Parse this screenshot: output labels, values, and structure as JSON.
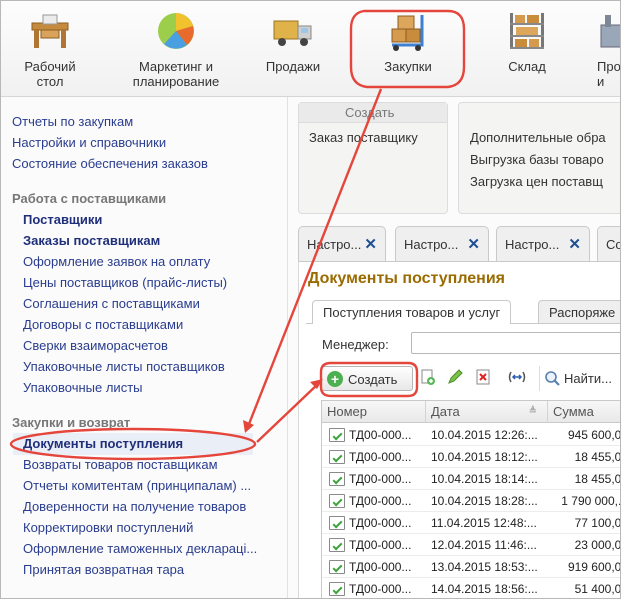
{
  "sections": [
    {
      "label": "Рабочий\nстол",
      "icon": "desk-icon"
    },
    {
      "label": "Маркетинг и\nпланирование",
      "icon": "pie-chart-icon"
    },
    {
      "label": "Продажи",
      "icon": "truck-icon"
    },
    {
      "label": "Закупки",
      "icon": "boxes-cart-icon"
    },
    {
      "label": "Склад",
      "icon": "shelf-icon"
    },
    {
      "label": "Про\nи",
      "icon": "production-icon"
    }
  ],
  "nav": {
    "top_links": [
      "Отчеты по закупкам",
      "Настройки и справочники",
      "Состояние обеспечения заказов"
    ],
    "group1": {
      "title": "Работа с поставщиками",
      "items": [
        {
          "label": "Поставщики",
          "bold": true
        },
        {
          "label": "Заказы поставщикам",
          "bold": true
        },
        {
          "label": "Оформление заявок на оплату",
          "bold": false
        },
        {
          "label": "Цены поставщиков (прайс-листы)",
          "bold": false
        },
        {
          "label": "Соглашения с поставщиками",
          "bold": false
        },
        {
          "label": "Договоры с поставщиками",
          "bold": false
        },
        {
          "label": "Сверки взаиморасчетов",
          "bold": false
        },
        {
          "label": "Упаковочные листы поставщиков",
          "bold": false
        },
        {
          "label": "Упаковочные листы",
          "bold": false
        }
      ]
    },
    "group2": {
      "title": "Закупки и возврат",
      "items": [
        {
          "label": "Документы поступления",
          "bold": true
        },
        {
          "label": "Возвраты товаров поставщикам",
          "bold": false
        },
        {
          "label": "Отчеты комитентам (принципалам) ...",
          "bold": false
        },
        {
          "label": "Доверенности на получение товаров",
          "bold": false
        },
        {
          "label": "Корректировки поступлений",
          "bold": false
        },
        {
          "label": "Оформление таможенных деклараці...",
          "bold": false
        },
        {
          "label": "Принятая возвратная тара",
          "bold": false
        }
      ]
    }
  },
  "create_panel": {
    "title": "Создать",
    "items": [
      "Заказ поставщику"
    ]
  },
  "service_panel": {
    "items": [
      "Дополнительные обра",
      "Выгрузка базы товаро",
      "Загрузка цен поставщ"
    ]
  },
  "doc_tabs": [
    "Настро...",
    "Настро...",
    "Настро...",
    "Со"
  ],
  "form": {
    "title": "Документы поступления",
    "tabs": [
      "Поступления товаров и услуг",
      "Распоряже"
    ],
    "manager_label": "Менеджер:",
    "manager_value": "",
    "create_button": "Создать",
    "find_button": "Найти...",
    "columns": [
      "Номер",
      "Дата",
      "Сумма"
    ],
    "rows": [
      {
        "number": "ТД00-000...",
        "date": "10.04.2015 12:26:...",
        "sum": "945 600,00"
      },
      {
        "number": "ТД00-000...",
        "date": "10.04.2015 18:12:...",
        "sum": "18 455,00"
      },
      {
        "number": "ТД00-000...",
        "date": "10.04.2015 18:14:...",
        "sum": "18 455,00"
      },
      {
        "number": "ТД00-000...",
        "date": "10.04.2015 18:28:...",
        "sum": "1 790 000,..."
      },
      {
        "number": "ТД00-000...",
        "date": "11.04.2015 12:48:...",
        "sum": "77 100,00"
      },
      {
        "number": "ТД00-000...",
        "date": "12.04.2015 11:46:...",
        "sum": "23 000,00"
      },
      {
        "number": "ТД00-000...",
        "date": "13.04.2015 18:53:...",
        "sum": "919 600,00"
      },
      {
        "number": "ТД00-000...",
        "date": "14.04.2015 18:56:...",
        "sum": "51 400,00"
      }
    ]
  },
  "colors": {
    "highlight": "#e5463c",
    "link": "#2a3d8f",
    "title": "#9a6b00",
    "tab_close": "#1d4f91"
  }
}
